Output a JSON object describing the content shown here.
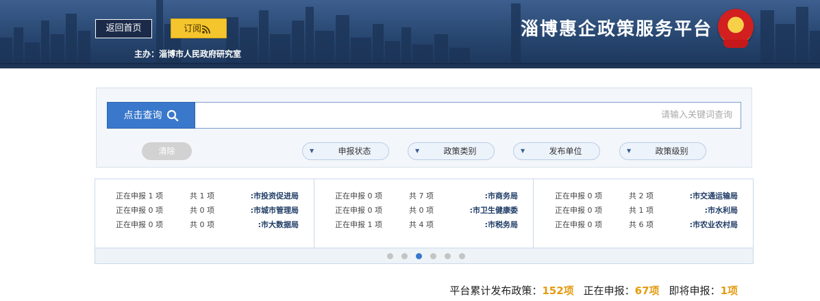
{
  "header": {
    "title": "淄博惠企政策服务平台",
    "host_label": "主办：",
    "host_name": "淄博市人民政府研究室",
    "home_button": "返回首页",
    "subscribe_button": "订阅",
    "subscribe_icon": "rss-icon",
    "emblem_icon": "national-emblem-icon",
    "colors": {
      "banner": "#27466f",
      "subscribe": "#f4c52c"
    }
  },
  "search": {
    "placeholder": "请输入关键词查询",
    "button_label": "点击查询",
    "button_icon": "search-icon",
    "filters": [
      "政策级别",
      "发布单位",
      "政策类别",
      "申报状态"
    ],
    "clear_label": "清除",
    "accent": "#3a78cc"
  },
  "stats": {
    "columns": [
      [
        {
          "agency": "市交通运输局:",
          "total": "共 2 项",
          "active": "正在申报 0 项"
        },
        {
          "agency": "市水利局:",
          "total": "共 1 项",
          "active": "正在申报 0 项"
        },
        {
          "agency": "市农业农村局:",
          "total": "共 6 项",
          "active": "正在申报 0 项"
        }
      ],
      [
        {
          "agency": "市商务局:",
          "total": "共 7 项",
          "active": "正在申报 0 项"
        },
        {
          "agency": "市卫生健康委:",
          "total": "共 0 项",
          "active": "正在申报 0 项"
        },
        {
          "agency": "市税务局:",
          "total": "共 4 项",
          "active": "正在申报 1 项"
        }
      ],
      [
        {
          "agency": "市投资促进局:",
          "total": "共 1 项",
          "active": "正在申报 1 项"
        },
        {
          "agency": "市城市管理局:",
          "total": "共 0 项",
          "active": "正在申报 0 项"
        },
        {
          "agency": "市大数据局:",
          "total": "共 0 项",
          "active": "正在申报 0 项"
        }
      ]
    ],
    "dot_count": 6,
    "active_dot": 2
  },
  "summary": {
    "total_label": "平台累计发布政策：",
    "total_value": "152项",
    "active_label": "正在申报：",
    "active_value": "67项",
    "upcoming_label": "即将申报：",
    "upcoming_value": "1项",
    "highlight": "#e49b0f"
  }
}
